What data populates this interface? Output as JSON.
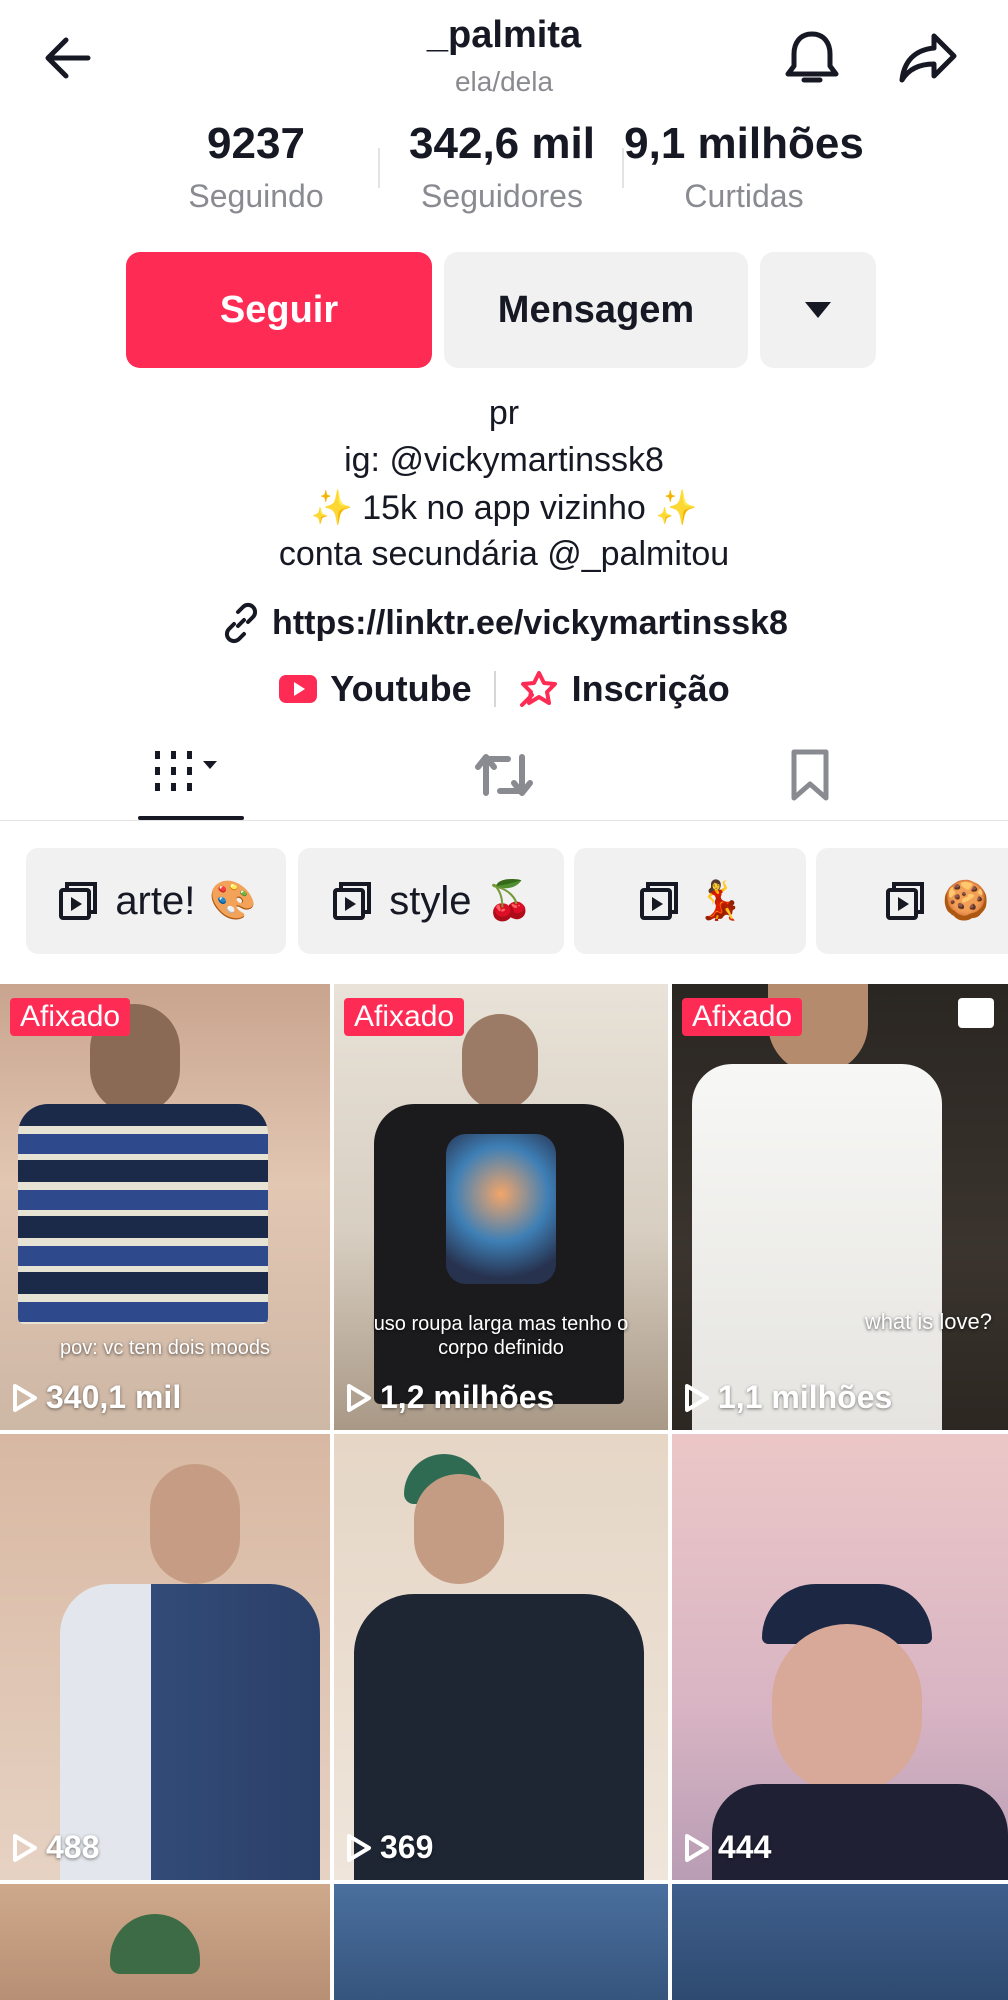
{
  "header": {
    "username": "_palmita",
    "pronouns": "ela/dela",
    "icons": [
      "back-arrow-icon",
      "bell-icon",
      "share-icon"
    ]
  },
  "stats": [
    {
      "value": "9237",
      "label": "Seguindo"
    },
    {
      "value": "342,6 mil",
      "label": "Seguidores"
    },
    {
      "value": "9,1 milhões",
      "label": "Curtidas"
    }
  ],
  "actions": {
    "follow": "Seguir",
    "message": "Mensagem",
    "more_icon": "triangle-down-icon"
  },
  "bio": {
    "lines": [
      "pr",
      "ig: @vickymartinssk8",
      "✨ 15k no app vizinho ✨",
      "conta secundária @_palmitou"
    ],
    "link": "https://linktr.ee/vickymartinssk8",
    "social": [
      {
        "label": "Youtube",
        "icon": "youtube-icon"
      },
      {
        "label": "Inscrição",
        "icon": "subscription-icon"
      }
    ]
  },
  "tabs": [
    {
      "icon": "grid-icon",
      "active": true
    },
    {
      "icon": "repost-icon",
      "active": false
    },
    {
      "icon": "bookmark-icon",
      "active": false
    }
  ],
  "playlists": [
    {
      "label": "arte!",
      "emoji": "🎨"
    },
    {
      "label": "style",
      "emoji": "🍒"
    },
    {
      "label": "",
      "emoji": "💃"
    },
    {
      "label": "",
      "emoji": "🍪"
    }
  ],
  "videos": [
    {
      "pinned": "Afixado",
      "views": "340,1 mil",
      "caption": "pov: vc tem dois moods"
    },
    {
      "pinned": "Afixado",
      "views": "1,2 milhões",
      "caption": "uso roupa larga mas tenho o corpo definido"
    },
    {
      "pinned": "Afixado",
      "views": "1,1 milhões",
      "caption": "what is love?"
    },
    {
      "views": "488"
    },
    {
      "views": "369"
    },
    {
      "views": "444"
    }
  ],
  "colors": {
    "accent": "#fe2c55",
    "button_bg": "#f1f1f2",
    "muted_text": "#8a8b91"
  }
}
